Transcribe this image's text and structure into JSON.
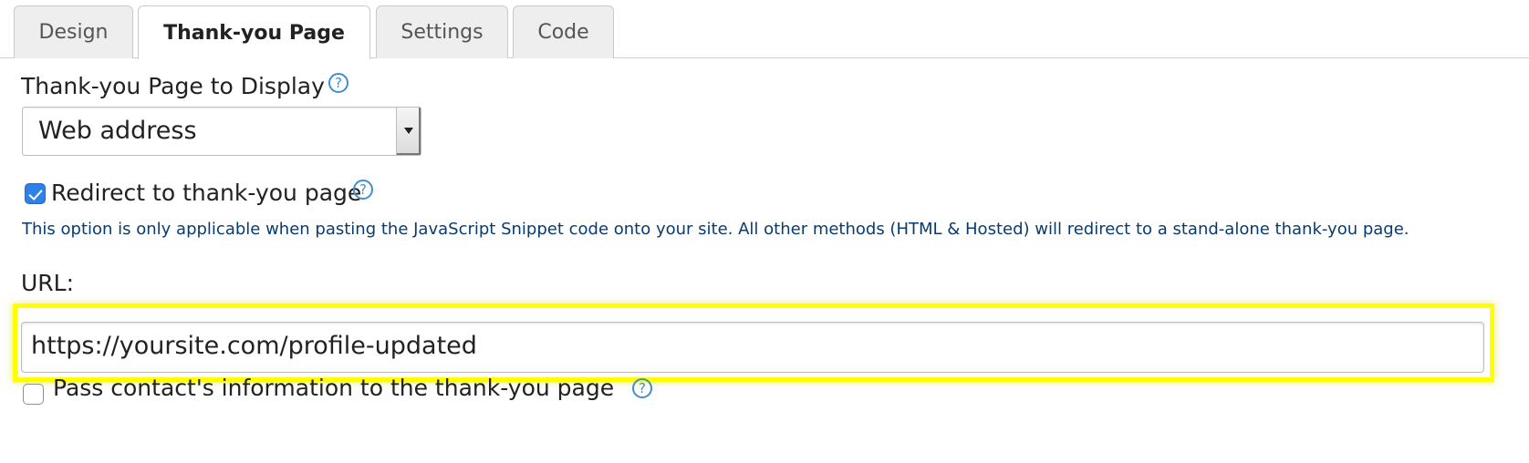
{
  "tabs": [
    {
      "label": "Design",
      "active": false
    },
    {
      "label": "Thank-you Page",
      "active": true
    },
    {
      "label": "Settings",
      "active": false
    },
    {
      "label": "Code",
      "active": false
    }
  ],
  "thank_you_page": {
    "label": "Thank-you Page to Display",
    "help_icon": "question-circle-icon",
    "select": {
      "selected_value": "Web address"
    }
  },
  "redirect": {
    "checked": true,
    "label": "Redirect to thank-you page",
    "help_icon": "question-circle-icon",
    "note": "This option is only applicable when pasting the JavaScript Snippet code onto your site. All other methods (HTML & Hosted) will redirect to a stand-alone thank-you page."
  },
  "url": {
    "label": "URL:",
    "value": "https://yoursite.com/profile-updated",
    "highlight_color": "#ffff00"
  },
  "pass_contact": {
    "checked": false,
    "label": "Pass contact's information to the thank-you page",
    "help_icon": "question-circle-icon"
  },
  "colors": {
    "help_icon": "#3f8fd0",
    "checkbox_checked": "#2f80e9",
    "note_text": "#083b70"
  },
  "icons": {
    "help": "?"
  }
}
